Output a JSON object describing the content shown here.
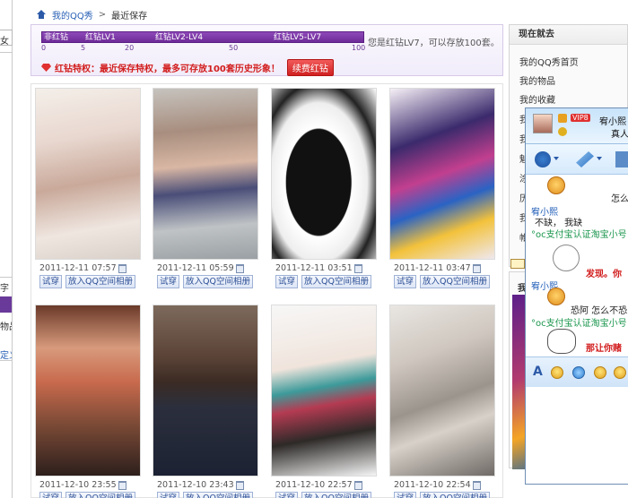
{
  "breadcrumb": {
    "home": "我的QQ秀",
    "sep": ">",
    "current": "最近保存"
  },
  "level_bar": {
    "levels": [
      "非红钻",
      "红钻LV1",
      "红钻LV2-LV4",
      "红钻LV5-LV7"
    ],
    "scale": [
      "0",
      "5",
      "20",
      "50",
      "100"
    ],
    "info": "您是红钻LV7，可以存放100套。",
    "privilege": "红钻特权：最近保存特权，最多可存放100套历史形象！",
    "renew_button": "续费红钻"
  },
  "outfits": [
    {
      "date": "2011-12-11 07:57"
    },
    {
      "date": "2011-12-11 05:59"
    },
    {
      "date": "2011-12-11 03:51"
    },
    {
      "date": "2011-12-11 03:47"
    },
    {
      "date": "2011-12-10 23:55"
    },
    {
      "date": "2011-12-10 23:43"
    },
    {
      "date": "2011-12-10 22:57"
    },
    {
      "date": "2011-12-10 22:54"
    }
  ],
  "card_buttons": {
    "try": "试穿",
    "add": "放入QQ空间相册"
  },
  "left_sidebar": {
    "fragments": [
      "女",
      "字",
      "物品",
      "定义"
    ]
  },
  "right_sidebar": {
    "title": "现在就去",
    "items": [
      "我的QQ秀首页",
      "我的物品",
      "我的收藏",
      "我",
      "我",
      "魅",
      "涂",
      "历",
      "我",
      "帷"
    ]
  },
  "second_box": {
    "title": "我"
  },
  "chat": {
    "badge": "VIP8",
    "name_top": "宥小熙",
    "name_top2": "真人",
    "nick": "宥小熙",
    "lines": [
      "怎么",
      "不缺，   我缺",
      "°oc支付宝认证淘宝小号",
      "发现。你",
      "宥小熙",
      "恐阿  怎么不恐",
      "°oc支付宝认证淘宝小号",
      "那让你赌"
    ]
  },
  "colors": {
    "accent_link": "#2a61b6",
    "red": "#d21d1d",
    "purple": "#6d2b98"
  }
}
